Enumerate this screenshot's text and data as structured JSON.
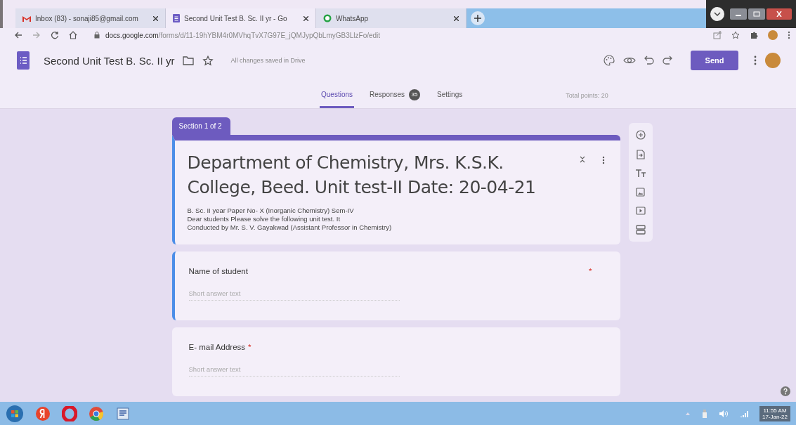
{
  "browser_tabs": [
    {
      "kind": "gmail",
      "title": "Inbox (83) - sonaji85@gmail.com",
      "selected": false
    },
    {
      "kind": "forms",
      "title": "Second Unit Test B. Sc. II yr - Go",
      "selected": true
    },
    {
      "kind": "whatsapp",
      "title": "WhatsApp",
      "selected": false
    }
  ],
  "address_bar": {
    "host": "docs.google.com",
    "path": "/forms/d/11-19hYBM4r0MVhqTvX7G97E_jQMJypQbLmyGB3LlzFo/edit"
  },
  "form_header": {
    "title": "Second Unit Test B. Sc. II yr",
    "save_status": "All changes saved in Drive",
    "send_label": "Send"
  },
  "nav_tabs": [
    {
      "label": "Questions",
      "selected": true
    },
    {
      "label": "Responses",
      "badge": "35",
      "selected": false
    },
    {
      "label": "Settings",
      "selected": false
    }
  ],
  "total_points": "Total points: 20",
  "section": {
    "label": "Section 1 of 2",
    "title": "Department of Chemistry, Mrs. K.S.K. College, Beed. Unit test-II Date: 20-04-21",
    "description": [
      "B. Sc. II year Paper No- X (Inorganic Chemistry) Sem-IV",
      "Dear students Please solve the following unit test. It",
      "Conducted by Mr. S. V. Gayakwad (Assistant Professor in Chemistry)"
    ]
  },
  "questions": [
    {
      "title": "Name of student",
      "placeholder": "Short answer text",
      "required_mark": "*",
      "selected": true
    },
    {
      "title": "E- mail Address",
      "placeholder": "Short answer text",
      "required_mark": "*",
      "selected": false
    }
  ],
  "taskbar": {
    "time": "11:55 AM",
    "date": "17-Jan-22"
  }
}
